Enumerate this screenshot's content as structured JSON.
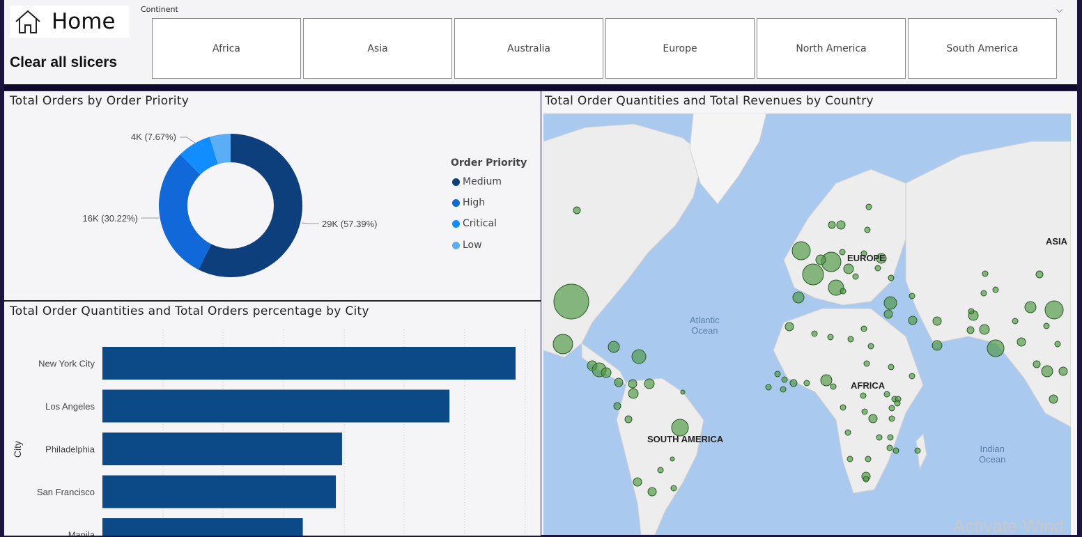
{
  "header": {
    "home_label": "Home",
    "clear_label": "Clear all slicers"
  },
  "slicer": {
    "title": "Continent",
    "options": [
      "Africa",
      "Asia",
      "Australia",
      "Europe",
      "North America",
      "South America"
    ]
  },
  "donut": {
    "title": "Total Orders by Order Priority",
    "legend_title": "Order Priority",
    "legend": [
      {
        "label": "Medium",
        "color": "#0d3f7c"
      },
      {
        "label": "High",
        "color": "#1168d9"
      },
      {
        "label": "Critical",
        "color": "#118dff"
      },
      {
        "label": "Low",
        "color": "#5aaef5"
      }
    ],
    "labels": [
      "29K (57.39%)",
      "16K (30.22%)",
      "4K (7.67%)"
    ]
  },
  "bars": {
    "title": "Total Order Quantities and Total Orders percentage by City",
    "ylabel": "City"
  },
  "map": {
    "title": "Total Order Quantities and Total Revenues by Country",
    "labels": {
      "europe": "EUROPE",
      "asia": "ASIA",
      "africa": "AFRICA",
      "south_america": "SOUTH AMERICA"
    },
    "oceans": {
      "atlantic_1": "Atlantic",
      "atlantic_2": "Ocean",
      "indian_1": "Indian",
      "indian_2": "Ocean"
    }
  },
  "watermark": "Activate Wind",
  "chart_data": [
    {
      "type": "pie",
      "title": "Total Orders by Order Priority",
      "categories": [
        "Medium",
        "High",
        "Critical",
        "Low"
      ],
      "values": [
        57.39,
        30.22,
        7.67,
        4.72
      ],
      "data_labels": [
        "29K (57.39%)",
        "16K (30.22%)",
        "4K (7.67%)"
      ],
      "legend": "right"
    },
    {
      "type": "bar",
      "orientation": "horizontal",
      "title": "Total Order Quantities and Total Orders percentage by City",
      "ylabel": "City",
      "categories": [
        "New York City",
        "Los Angeles",
        "Philadelphia",
        "San Francisco",
        "Manila"
      ],
      "values": [
        100,
        84,
        58,
        56.5,
        48.5
      ]
    }
  ]
}
